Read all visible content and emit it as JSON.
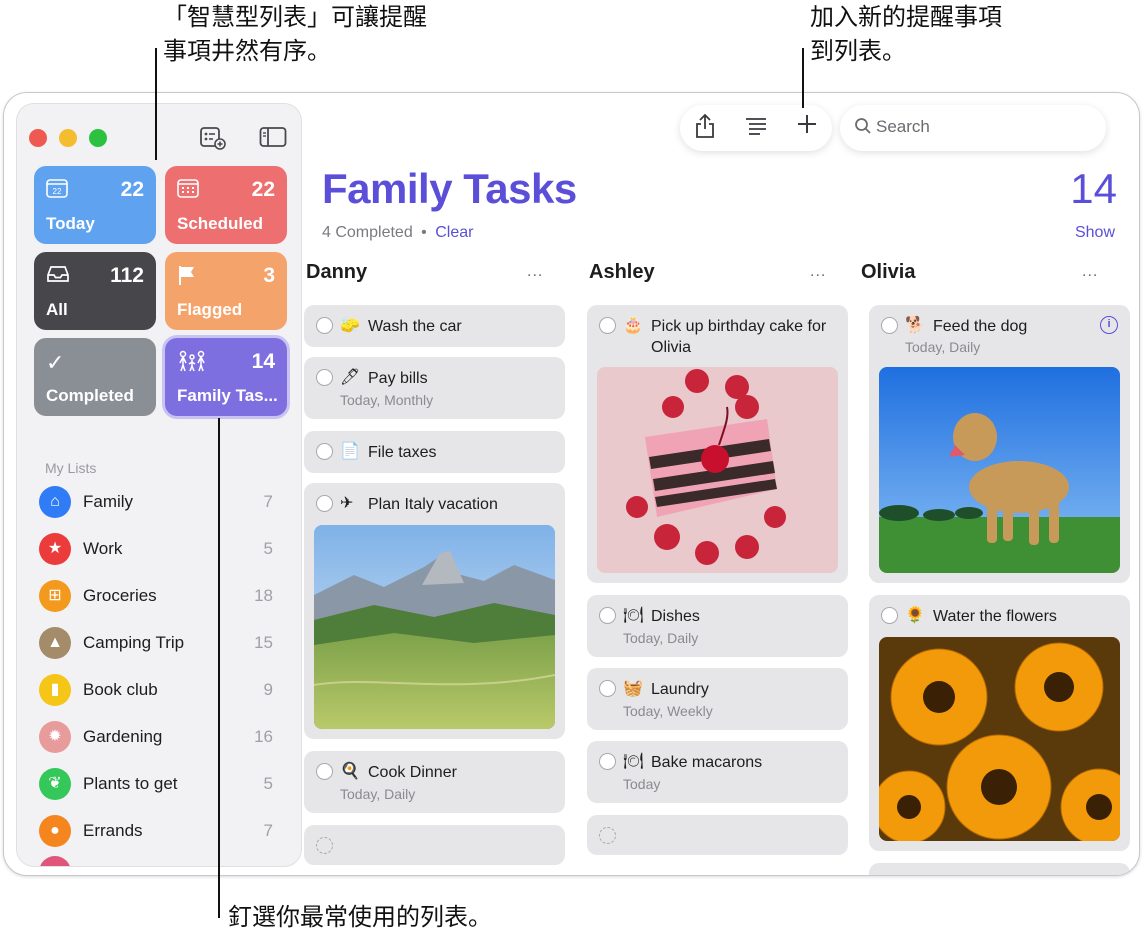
{
  "annotations": {
    "smart_lists": "「智慧型列表」可讓提醒\n事項井然有序。",
    "add_reminder": "加入新的提醒事項\n到列表。",
    "pin_lists": "釘選你最常使用的列表。"
  },
  "colors": {
    "accent": "#5b4fd9",
    "today": "#5fa2f0",
    "scheduled": "#ee6f6f",
    "all": "#47474b",
    "flagged": "#f4a36b",
    "completed": "#8a8f96",
    "family_tasks": "#7e6fe0"
  },
  "smart_lists": [
    {
      "label": "Today",
      "count": "22",
      "icon": "calendar-today-icon",
      "glyph": "22"
    },
    {
      "label": "Scheduled",
      "count": "22",
      "icon": "calendar-icon",
      "glyph": "▦"
    },
    {
      "label": "All",
      "count": "112",
      "icon": "tray-icon",
      "glyph": "▭"
    },
    {
      "label": "Flagged",
      "count": "3",
      "icon": "flag-icon",
      "glyph": "⚑"
    },
    {
      "label": "Completed",
      "count": "",
      "icon": "checkmark-icon",
      "glyph": "✓"
    },
    {
      "label": "Family Tas...",
      "count": "14",
      "icon": "family-icon",
      "glyph": "👪"
    }
  ],
  "my_lists_heading": "My Lists",
  "my_lists": [
    {
      "name": "Family",
      "count": "7",
      "icon": "house-icon",
      "glyph": "⌂",
      "color": "#2f7cf6"
    },
    {
      "name": "Work",
      "count": "5",
      "icon": "star-icon",
      "glyph": "★",
      "color": "#ec3b3b"
    },
    {
      "name": "Groceries",
      "count": "18",
      "icon": "basket-icon",
      "glyph": "⊞",
      "color": "#f39a1e"
    },
    {
      "name": "Camping Trip",
      "count": "15",
      "icon": "tent-icon",
      "glyph": "▲",
      "color": "#a48b6a"
    },
    {
      "name": "Book club",
      "count": "9",
      "icon": "bookmark-icon",
      "glyph": "▮",
      "color": "#f5c518"
    },
    {
      "name": "Gardening",
      "count": "16",
      "icon": "sun-icon",
      "glyph": "✹",
      "color": "#e79b9b"
    },
    {
      "name": "Plants to get",
      "count": "5",
      "icon": "leaf-icon",
      "glyph": "❦",
      "color": "#34c759"
    },
    {
      "name": "Errands",
      "count": "7",
      "icon": "circle-icon",
      "glyph": "●",
      "color": "#f5851f"
    }
  ],
  "search": {
    "placeholder": "Search"
  },
  "main": {
    "title": "Family Tasks",
    "count": "14",
    "completed_text": "4 Completed",
    "bullet": "•",
    "clear_label": "Clear",
    "show_label": "Show"
  },
  "columns": [
    {
      "name": "Danny",
      "more": "...",
      "tasks": [
        {
          "title": "Wash the car",
          "sub": "",
          "emoji": "🧽"
        },
        {
          "title": "Pay bills",
          "sub": "Today, Monthly",
          "emoji": "🖊"
        },
        {
          "title": "File taxes",
          "sub": "",
          "emoji": "📄"
        },
        {
          "title": "Plan Italy vacation",
          "sub": "",
          "emoji": "✈"
        },
        {
          "title": "Cook Dinner",
          "sub": "Today, Daily",
          "emoji": "🍳"
        }
      ]
    },
    {
      "name": "Ashley",
      "more": "...",
      "tasks": [
        {
          "title": "Pick up birthday cake for Olivia",
          "sub": "",
          "emoji": "🎂"
        },
        {
          "title": "Dishes",
          "sub": "Today, Daily",
          "emoji": "🍽"
        },
        {
          "title": "Laundry",
          "sub": "Today, Weekly",
          "emoji": "🧺"
        },
        {
          "title": "Bake macarons",
          "sub": "Today",
          "emoji": "🍽"
        }
      ]
    },
    {
      "name": "Olivia",
      "more": "...",
      "tasks": [
        {
          "title": "Feed the dog",
          "sub": "Today, Daily",
          "emoji": "🐕"
        },
        {
          "title": "Water the flowers",
          "sub": "",
          "emoji": "🌻"
        }
      ]
    }
  ]
}
